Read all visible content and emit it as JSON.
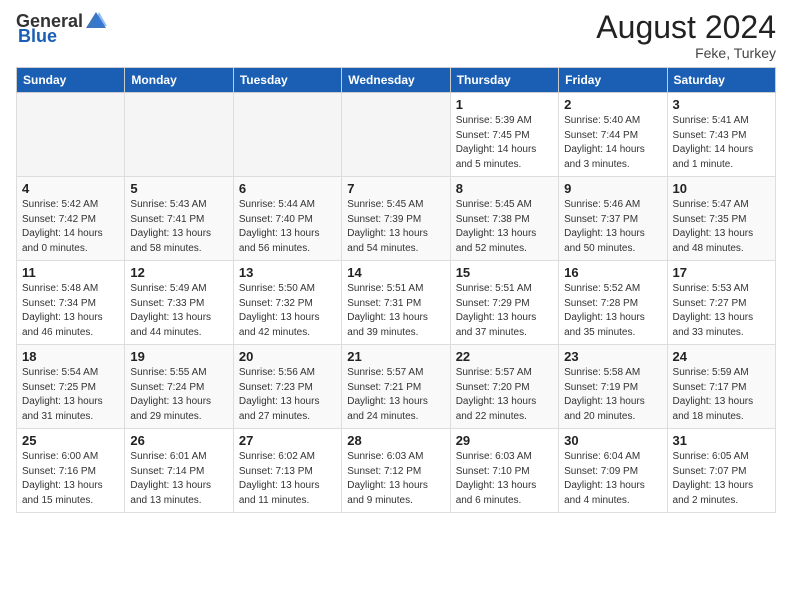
{
  "header": {
    "logo_general": "General",
    "logo_blue": "Blue",
    "month_year": "August 2024",
    "location": "Feke, Turkey"
  },
  "weekdays": [
    "Sunday",
    "Monday",
    "Tuesday",
    "Wednesday",
    "Thursday",
    "Friday",
    "Saturday"
  ],
  "weeks": [
    [
      {
        "day": "",
        "info": ""
      },
      {
        "day": "",
        "info": ""
      },
      {
        "day": "",
        "info": ""
      },
      {
        "day": "",
        "info": ""
      },
      {
        "day": "1",
        "info": "Sunrise: 5:39 AM\nSunset: 7:45 PM\nDaylight: 14 hours\nand 5 minutes."
      },
      {
        "day": "2",
        "info": "Sunrise: 5:40 AM\nSunset: 7:44 PM\nDaylight: 14 hours\nand 3 minutes."
      },
      {
        "day": "3",
        "info": "Sunrise: 5:41 AM\nSunset: 7:43 PM\nDaylight: 14 hours\nand 1 minute."
      }
    ],
    [
      {
        "day": "4",
        "info": "Sunrise: 5:42 AM\nSunset: 7:42 PM\nDaylight: 14 hours\nand 0 minutes."
      },
      {
        "day": "5",
        "info": "Sunrise: 5:43 AM\nSunset: 7:41 PM\nDaylight: 13 hours\nand 58 minutes."
      },
      {
        "day": "6",
        "info": "Sunrise: 5:44 AM\nSunset: 7:40 PM\nDaylight: 13 hours\nand 56 minutes."
      },
      {
        "day": "7",
        "info": "Sunrise: 5:45 AM\nSunset: 7:39 PM\nDaylight: 13 hours\nand 54 minutes."
      },
      {
        "day": "8",
        "info": "Sunrise: 5:45 AM\nSunset: 7:38 PM\nDaylight: 13 hours\nand 52 minutes."
      },
      {
        "day": "9",
        "info": "Sunrise: 5:46 AM\nSunset: 7:37 PM\nDaylight: 13 hours\nand 50 minutes."
      },
      {
        "day": "10",
        "info": "Sunrise: 5:47 AM\nSunset: 7:35 PM\nDaylight: 13 hours\nand 48 minutes."
      }
    ],
    [
      {
        "day": "11",
        "info": "Sunrise: 5:48 AM\nSunset: 7:34 PM\nDaylight: 13 hours\nand 46 minutes."
      },
      {
        "day": "12",
        "info": "Sunrise: 5:49 AM\nSunset: 7:33 PM\nDaylight: 13 hours\nand 44 minutes."
      },
      {
        "day": "13",
        "info": "Sunrise: 5:50 AM\nSunset: 7:32 PM\nDaylight: 13 hours\nand 42 minutes."
      },
      {
        "day": "14",
        "info": "Sunrise: 5:51 AM\nSunset: 7:31 PM\nDaylight: 13 hours\nand 39 minutes."
      },
      {
        "day": "15",
        "info": "Sunrise: 5:51 AM\nSunset: 7:29 PM\nDaylight: 13 hours\nand 37 minutes."
      },
      {
        "day": "16",
        "info": "Sunrise: 5:52 AM\nSunset: 7:28 PM\nDaylight: 13 hours\nand 35 minutes."
      },
      {
        "day": "17",
        "info": "Sunrise: 5:53 AM\nSunset: 7:27 PM\nDaylight: 13 hours\nand 33 minutes."
      }
    ],
    [
      {
        "day": "18",
        "info": "Sunrise: 5:54 AM\nSunset: 7:25 PM\nDaylight: 13 hours\nand 31 minutes."
      },
      {
        "day": "19",
        "info": "Sunrise: 5:55 AM\nSunset: 7:24 PM\nDaylight: 13 hours\nand 29 minutes."
      },
      {
        "day": "20",
        "info": "Sunrise: 5:56 AM\nSunset: 7:23 PM\nDaylight: 13 hours\nand 27 minutes."
      },
      {
        "day": "21",
        "info": "Sunrise: 5:57 AM\nSunset: 7:21 PM\nDaylight: 13 hours\nand 24 minutes."
      },
      {
        "day": "22",
        "info": "Sunrise: 5:57 AM\nSunset: 7:20 PM\nDaylight: 13 hours\nand 22 minutes."
      },
      {
        "day": "23",
        "info": "Sunrise: 5:58 AM\nSunset: 7:19 PM\nDaylight: 13 hours\nand 20 minutes."
      },
      {
        "day": "24",
        "info": "Sunrise: 5:59 AM\nSunset: 7:17 PM\nDaylight: 13 hours\nand 18 minutes."
      }
    ],
    [
      {
        "day": "25",
        "info": "Sunrise: 6:00 AM\nSunset: 7:16 PM\nDaylight: 13 hours\nand 15 minutes."
      },
      {
        "day": "26",
        "info": "Sunrise: 6:01 AM\nSunset: 7:14 PM\nDaylight: 13 hours\nand 13 minutes."
      },
      {
        "day": "27",
        "info": "Sunrise: 6:02 AM\nSunset: 7:13 PM\nDaylight: 13 hours\nand 11 minutes."
      },
      {
        "day": "28",
        "info": "Sunrise: 6:03 AM\nSunset: 7:12 PM\nDaylight: 13 hours\nand 9 minutes."
      },
      {
        "day": "29",
        "info": "Sunrise: 6:03 AM\nSunset: 7:10 PM\nDaylight: 13 hours\nand 6 minutes."
      },
      {
        "day": "30",
        "info": "Sunrise: 6:04 AM\nSunset: 7:09 PM\nDaylight: 13 hours\nand 4 minutes."
      },
      {
        "day": "31",
        "info": "Sunrise: 6:05 AM\nSunset: 7:07 PM\nDaylight: 13 hours\nand 2 minutes."
      }
    ]
  ]
}
